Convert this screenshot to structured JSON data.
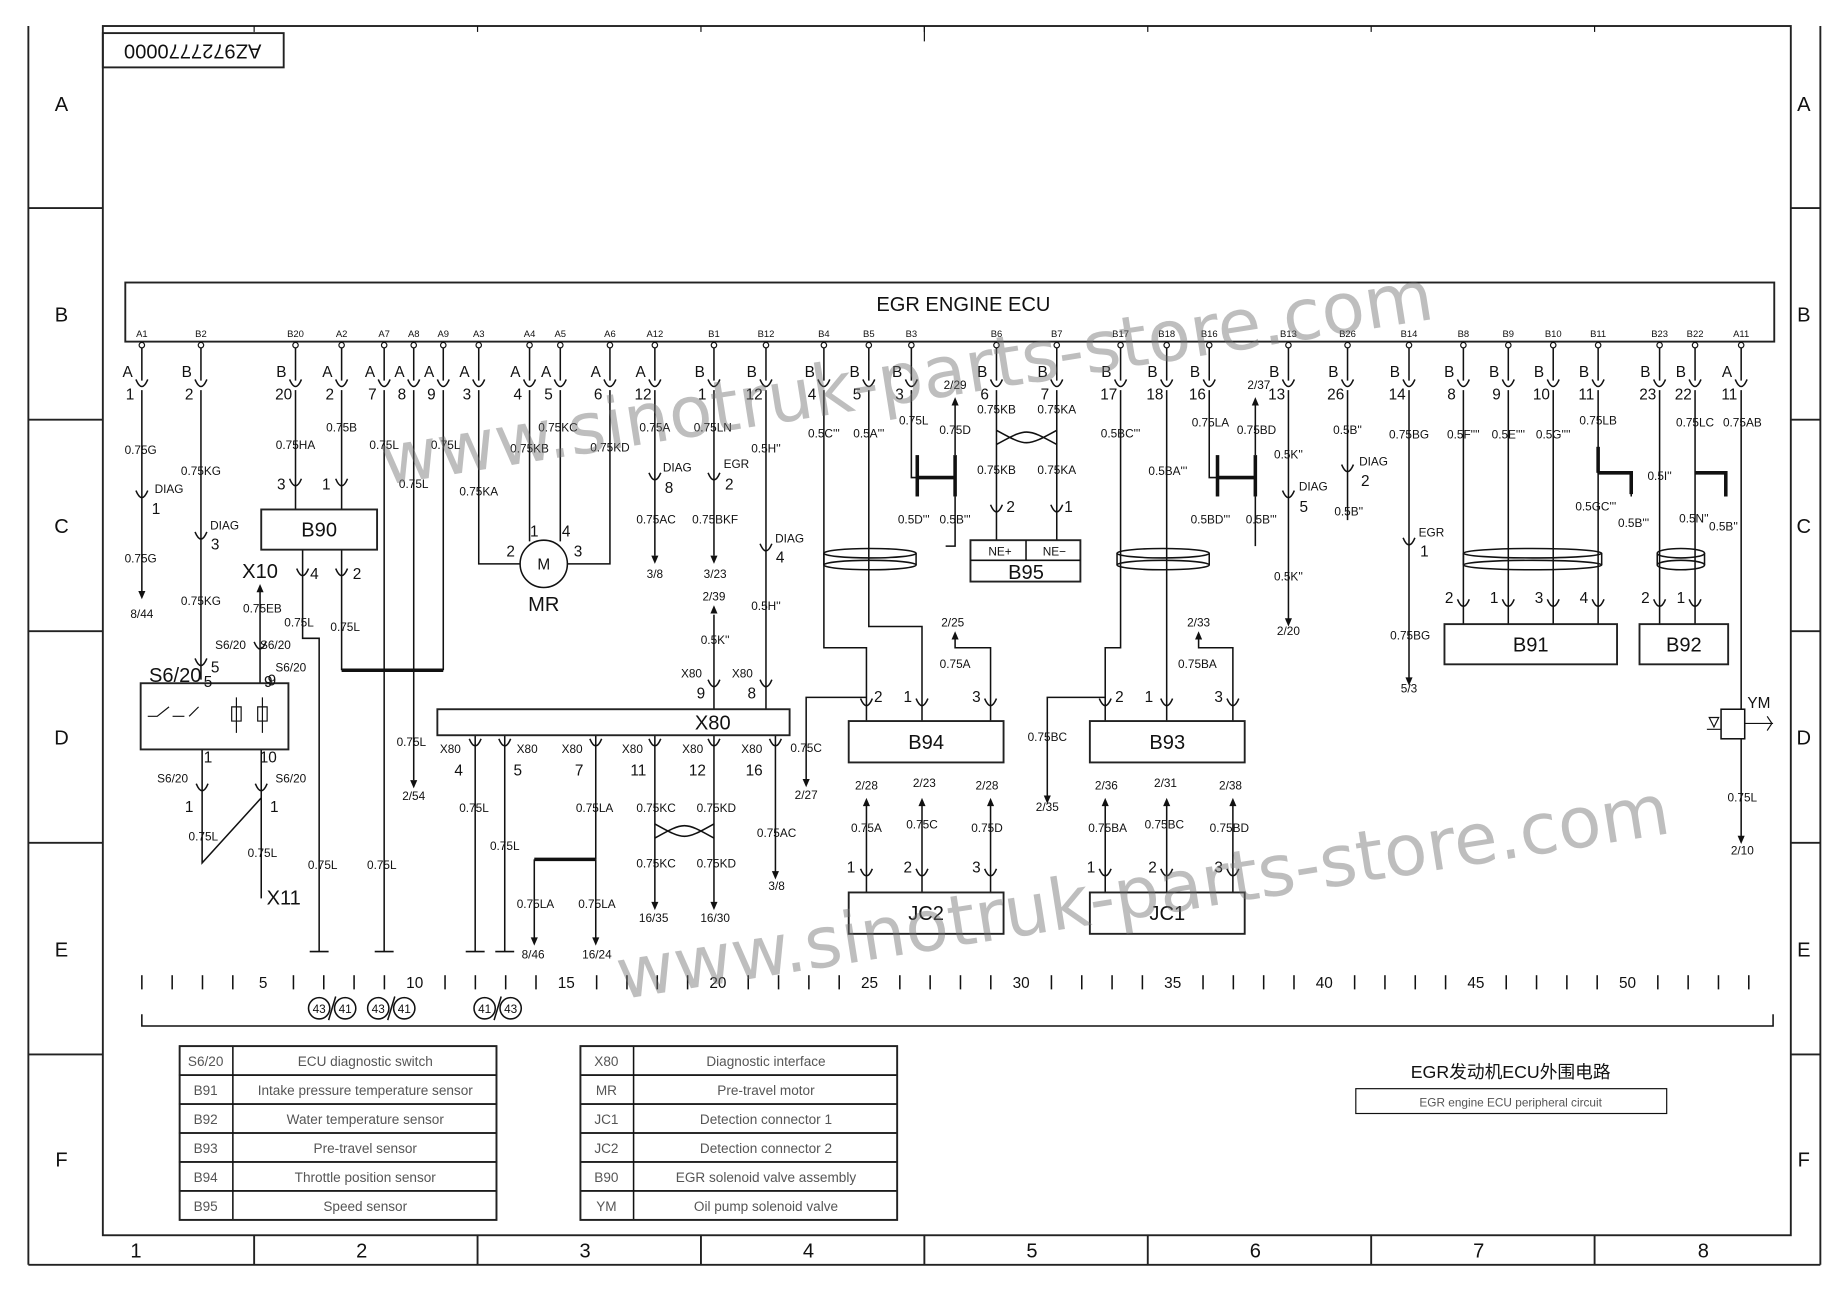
{
  "drawing_number": "AZ9727770000",
  "row_labels": [
    "A",
    "B",
    "C",
    "D",
    "E",
    "F"
  ],
  "column_labels": [
    "1",
    "2",
    "3",
    "4",
    "5",
    "6",
    "7",
    "8"
  ],
  "ecu": {
    "title": "EGR ENGINE ECU",
    "pins": [
      "A1",
      "B2",
      "B20",
      "A2",
      "A7",
      "A8",
      "A9",
      "A3",
      "A4",
      "A5",
      "A6",
      "A12",
      "B1",
      "B12",
      "B4",
      "B5",
      "B3",
      "B6",
      "B7",
      "B17",
      "B18",
      "B16",
      "B13",
      "B26",
      "B14",
      "B8",
      "B9",
      "B10",
      "B11",
      "B23",
      "B22",
      "A11"
    ]
  },
  "components": {
    "B90": "B90",
    "B91": "B91",
    "B92": "B92",
    "B93": "B93",
    "B94": "B94",
    "B95": "B95",
    "X80": "X80",
    "JC1": "JC1",
    "JC2": "JC2",
    "MR": "MR",
    "S620": "S6/20",
    "YM": "YM",
    "X10": "X10",
    "X11": "X11",
    "ne_plus": "NE+",
    "ne_minus": "NE−",
    "motor": "M"
  },
  "w": {
    "a1a": "0.75G",
    "a1d": "DIAG",
    "a1n": "1",
    "a1b": "0.75G",
    "a1r": "8/44",
    "b2a": "0.75KG",
    "b2d": "DIAG",
    "b2n": "3",
    "b2b": "0.75KG",
    "s6a": "S6/20",
    "s6an": "5",
    "s6b": "S6/20",
    "s6bn": "5",
    "s6c": "S6/20",
    "s6cn": "9",
    "x10w": "0.75EB",
    "b20a": "0.75HA",
    "b20n": "3",
    "a2a": "0.75B",
    "a2n": "1",
    "b90p4": "4",
    "b90p2": "2",
    "b90w4": "0.75L",
    "b90w2": "0.75L",
    "g1": "0.75L",
    "a7a": "0.75L",
    "a7b": "0.75L",
    "a8a": "0.75L",
    "a8b": "0.75L",
    "a8r": "2/54",
    "a9a": "0.75L",
    "s6d": "S6/20",
    "s6dn": "1",
    "s6e": "S6/20",
    "s6en": "1",
    "s6w1": "0.75L",
    "s6w2": "0.75L",
    "s6p5": "5",
    "s6p9": "9",
    "s6p1": "1",
    "s6p10": "10",
    "a3a": "0.75KA",
    "a4a": "0.75KB",
    "a5a": "0.75KC",
    "a6a": "0.75KD",
    "m1": "1",
    "m4": "4",
    "m2": "2",
    "m3": "3",
    "a12a": "0.75A",
    "a12d": "DIAG",
    "a12n": "8",
    "a12b": "0.75AC",
    "a12r": "3/8",
    "b1a": "0.75LN",
    "b1d": "EGR",
    "b1n": "2",
    "b1b": "0.75BKF",
    "b1r": "3/23",
    "x9r": "2/39",
    "x9w": "0.5K''",
    "x9a": "X80",
    "x9n": "9",
    "b12a": "0.5H''",
    "b12d": "DIAG",
    "b12n": "4",
    "b12b": "0.5H''",
    "x8a": "X80",
    "x8n": "8",
    "x4a": "X80",
    "x4n": "4",
    "x5a": "X80",
    "x5n": "5",
    "x7a": "X80",
    "x7n": "7",
    "x11a": "X80",
    "x11n": "11",
    "x12a": "X80",
    "x12n": "12",
    "x16a": "X80",
    "x16n": "16",
    "x4w": "0.75L",
    "x5w": "0.75L",
    "x7w": "0.75LA",
    "x7l": "0.75LA",
    "x7m": "0.75LA",
    "x7r1": "8/46",
    "x7r2": "16/24",
    "x11w": "0.75KC",
    "x11b": "0.75KC",
    "x11r": "16/35",
    "x12w": "0.75KD",
    "x12b": "0.75KD",
    "x12r": "16/30",
    "x16w": "0.75AC",
    "x16r": "3/8",
    "c27w": "0.75C",
    "c27r": "2/27",
    "b4a": "0.5C'''",
    "b5a": "0.5A'''",
    "b3a": "0.75L",
    "b3d": "0.75D",
    "b3r": "2/29",
    "b3l": "0.5D'''",
    "b3m": "0.5B'''",
    "r25": "2/25",
    "w25": "0.75A",
    "b94p2": "2",
    "b94p1": "1",
    "b94p3": "3",
    "b6a": "0.75KB",
    "b6b": "0.75KB",
    "b6n": "2",
    "b7a": "0.75KA",
    "b7b": "0.75KA",
    "b7n": "1",
    "b17a": "0.5BC'''",
    "b18a": "0.5BA'''",
    "b16a": "0.75LA",
    "b16d": "0.75BD",
    "b16r": "2/37",
    "b16l": "0.5BD'''",
    "b16m": "0.5B'''",
    "r33": "2/33",
    "w33": "0.75BA",
    "bcw": "0.75BC",
    "bcr": "2/35",
    "b93p2": "2",
    "b93p1": "1",
    "b93p3": "3",
    "b13a": "0.5K''",
    "b13d": "DIAG",
    "b13n": "5",
    "b13b": "0.5K''",
    "b13r": "2/20",
    "b26a": "0.5B''",
    "b26d": "DIAG",
    "b26n": "2",
    "b26b": "0.5B''",
    "b14a": "0.75BG",
    "b14d": "EGR",
    "b14n": "1",
    "b14b": "0.75BG",
    "b14r": "5/3",
    "b8a": "0.5F''''",
    "b9a": "0.5E''''",
    "b10a": "0.5G''''",
    "b11a": "0.75LB",
    "b11l": "0.5GC'''",
    "b11m": "0.5B'''",
    "b91p2": "2",
    "b91p1": "1",
    "b91p3": "3",
    "b91p4": "4",
    "b23a": "0.5I''",
    "b22a": "0.75LC",
    "b22l": "0.5N''",
    "b22m": "0.5B''",
    "b92p2": "2",
    "b92p1": "1",
    "a11a": "0.75AB",
    "a11b": "0.75L",
    "a11r": "2/10",
    "jc2w1": "0.75A",
    "jc2w2": "0.75C",
    "jc2w3": "0.75D",
    "jc2r1": "2/28",
    "jc2r2": "2/23",
    "jc2r3": "2/28",
    "jc2p1": "1",
    "jc2p2": "2",
    "jc2p3": "3",
    "jc1w1": "0.75BA",
    "jc1w2": "0.75BC",
    "jc1w3": "0.75BD",
    "jc1r1": "2/36",
    "jc1r2": "2/31",
    "jc1r3": "2/38",
    "jc1p1": "1",
    "jc1p2": "2",
    "jc1p3": "3"
  },
  "ruler": {
    "labels": [
      "5",
      "10",
      "15",
      "20",
      "25",
      "30",
      "35",
      "40",
      "45",
      "50"
    ]
  },
  "cross_refs": [
    [
      "43",
      "41"
    ],
    [
      "43",
      "41"
    ],
    [
      "41",
      "43"
    ]
  ],
  "legend_left": [
    {
      "code": "S6/20",
      "desc": "ECU diagnostic switch"
    },
    {
      "code": "B91",
      "desc": "Intake pressure temperature sensor"
    },
    {
      "code": "B92",
      "desc": "Water temperature sensor"
    },
    {
      "code": "B93",
      "desc": "Pre-travel sensor"
    },
    {
      "code": "B94",
      "desc": "Throttle position sensor"
    },
    {
      "code": "B95",
      "desc": "Speed sensor"
    }
  ],
  "legend_right": [
    {
      "code": "X80",
      "desc": "Diagnostic interface"
    },
    {
      "code": "MR",
      "desc": "Pre-travel motor"
    },
    {
      "code": "JC1",
      "desc": "Detection connector 1"
    },
    {
      "code": "JC2",
      "desc": "Detection connector 2"
    },
    {
      "code": "B90",
      "desc": "EGR solenoid valve assembly"
    },
    {
      "code": "YM",
      "desc": "Oil pump solenoid valve"
    }
  ],
  "title_block": {
    "title_cn": "EGR发动机ECU外围电路",
    "title_en": "EGR engine ECU peripheral circuit"
  },
  "watermark": "www.sinotruk-parts-store.com"
}
